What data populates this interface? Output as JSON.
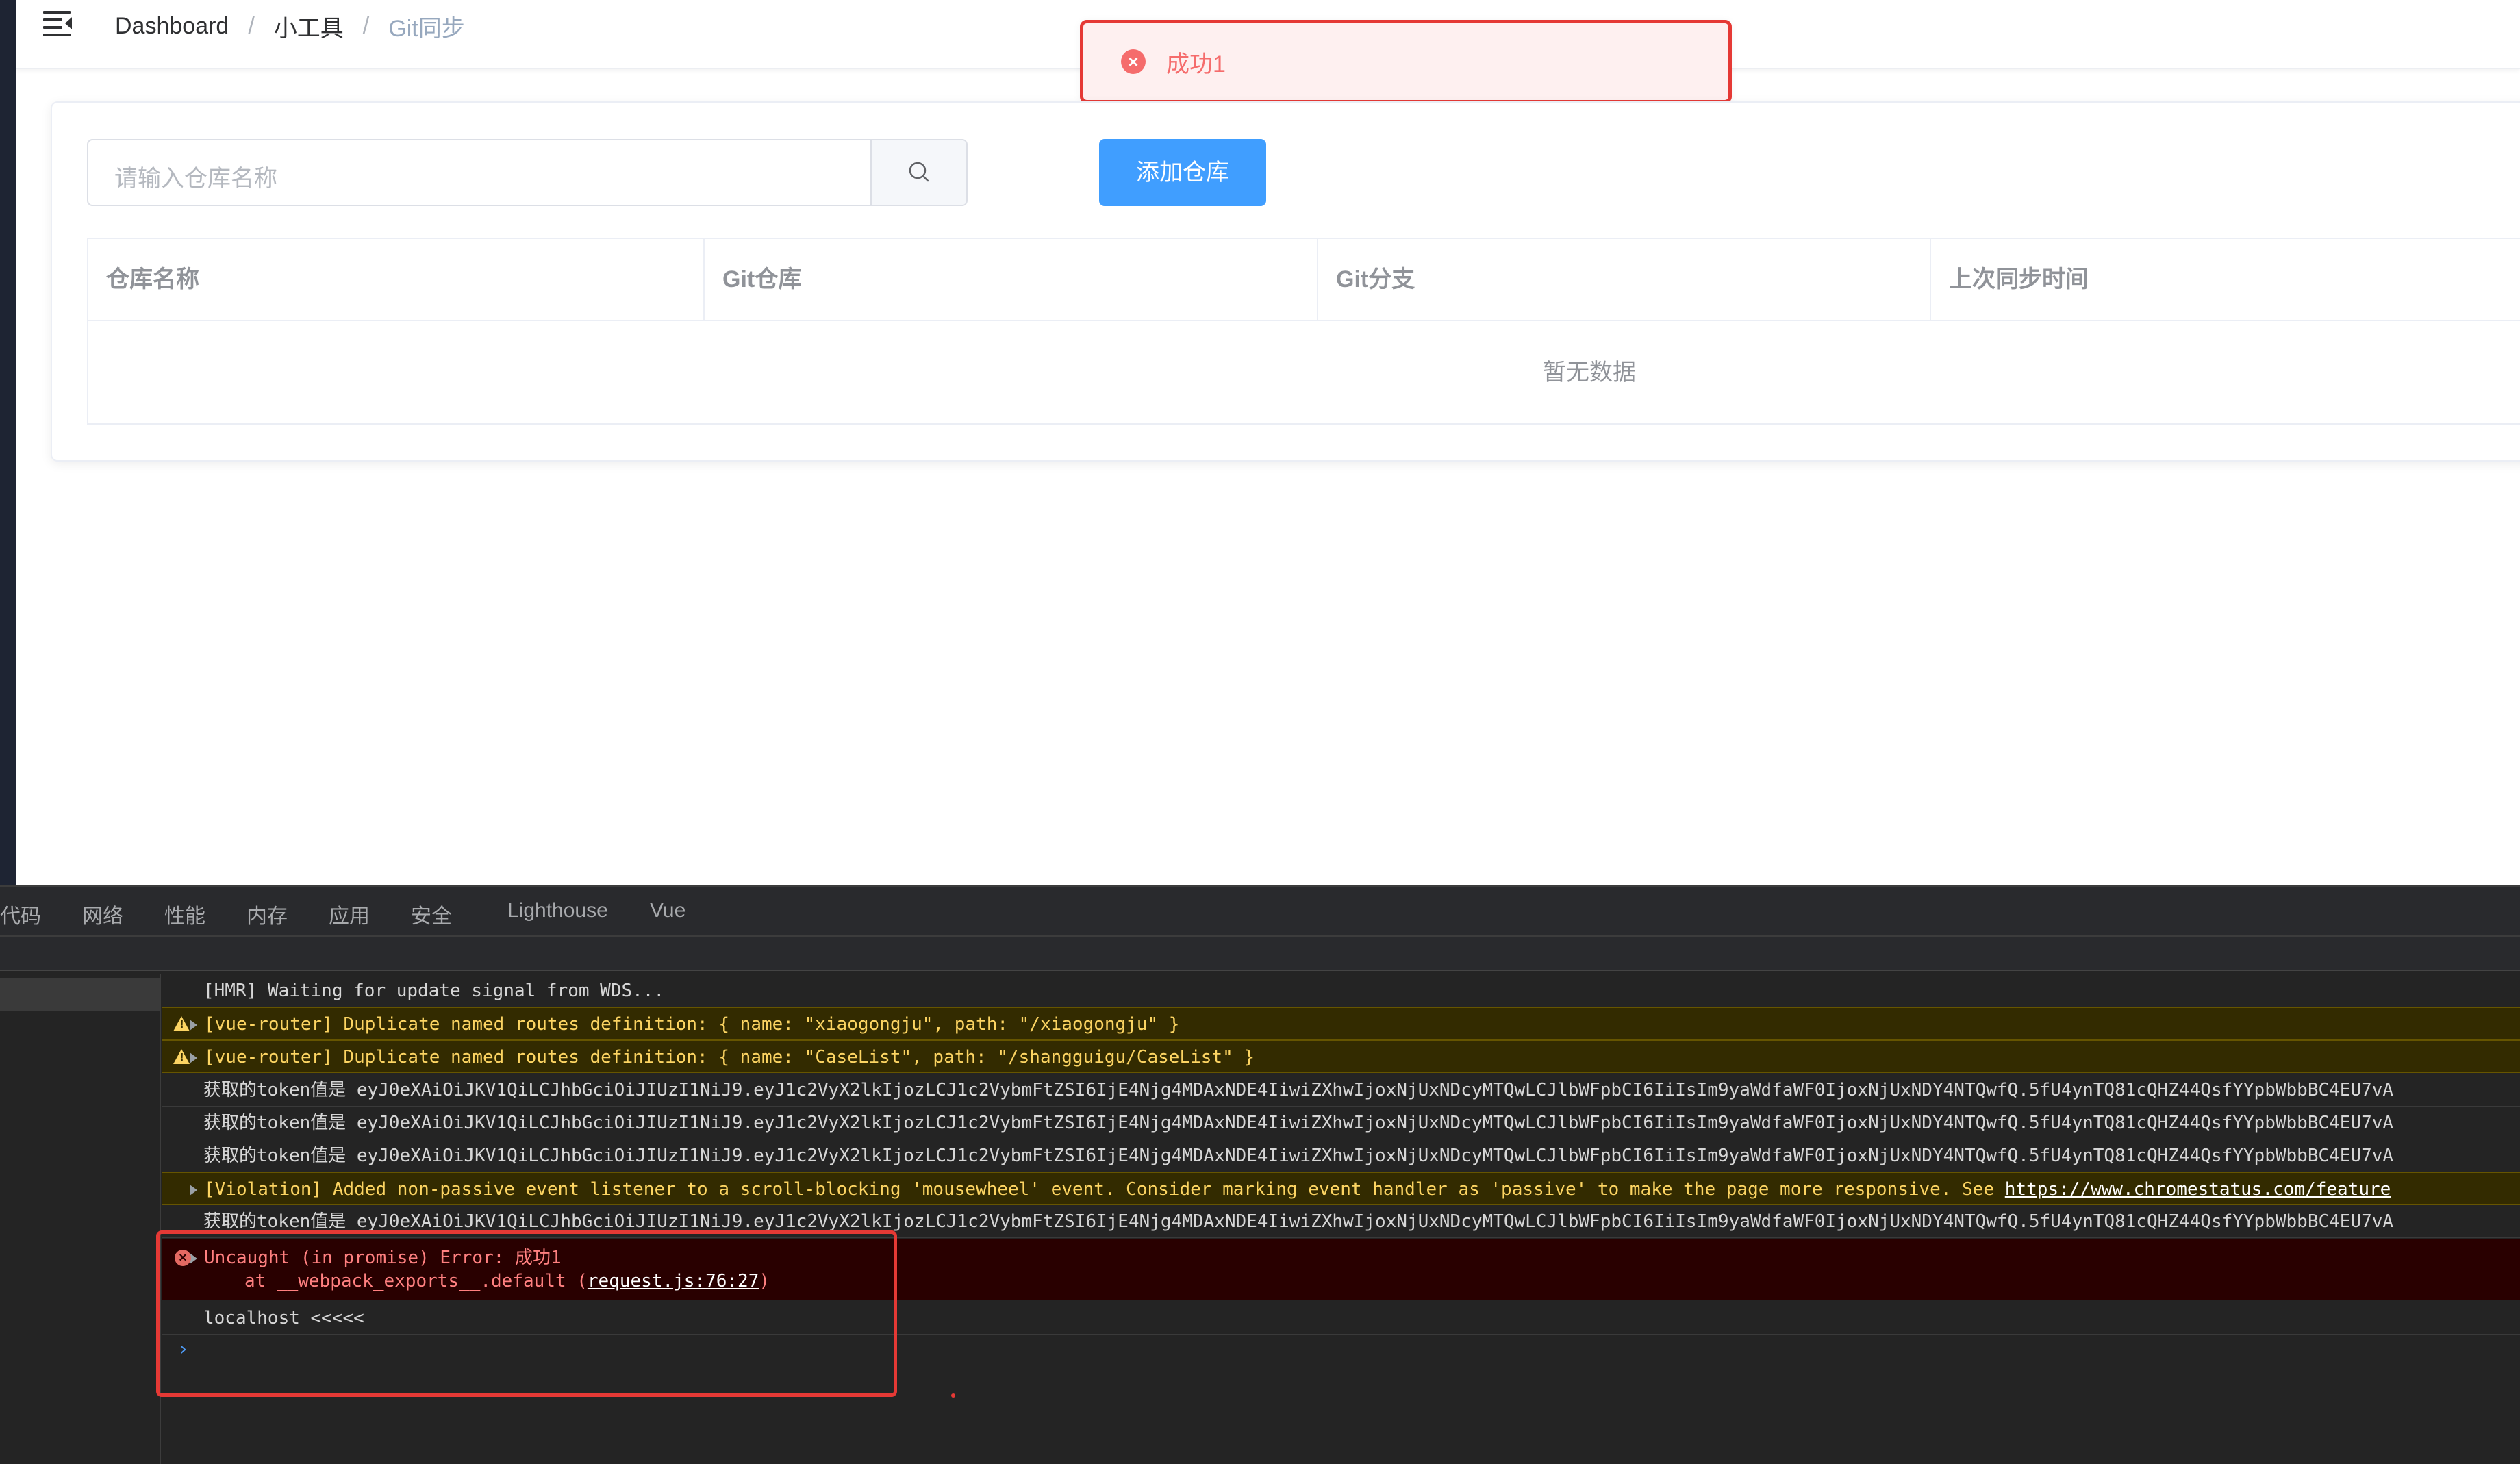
{
  "breadcrumb": {
    "items": [
      "Dashboard",
      "小工具",
      "Git同步"
    ],
    "separator": "/"
  },
  "toast": {
    "text": "成功1",
    "icon": "error-circle-icon",
    "color": "#f56c6c"
  },
  "search": {
    "placeholder": "请输入仓库名称",
    "button_icon": "search-icon"
  },
  "add_button": {
    "label": "添加仓库",
    "color": "#409eff"
  },
  "table": {
    "columns": [
      "仓库名称",
      "Git仓库",
      "Git分支",
      "上次同步时间"
    ],
    "empty_text": "暂无数据"
  },
  "devtools": {
    "tabs": [
      "代码",
      "网络",
      "性能",
      "内存",
      "应用",
      "安全",
      "Lighthouse",
      "Vue"
    ],
    "console": {
      "hmr": "[HMR] Waiting for update signal from WDS...",
      "warn1": "[vue-router] Duplicate named routes definition: { name: \"xiaogongju\", path: \"/xiaogongju\" }",
      "warn2": "[vue-router] Duplicate named routes definition: { name: \"CaseList\", path: \"/shangguigu/CaseList\" }",
      "token": "获取的token值是 eyJ0eXAiOiJKV1QiLCJhbGciOiJIUzI1NiJ9.eyJ1c2VyX2lkIjozLCJ1c2VybmFtZSI6IjE4Njg4MDAxNDE4IiwiZXhwIjoxNjUxNDcyMTQwLCJlbWFpbCI6IiIsIm9yaWdfaWF0IjoxNjUxNDY4NTQwfQ.5fU4ynTQ81cQHZ44QsfYYpbWbbBC4EU7vA",
      "violation": "[Violation] Added non-passive event listener to a scroll-blocking 'mousewheel' event. Consider marking event handler as 'passive' to make the page more responsive. See ",
      "violation_link": "https://www.chromestatus.com/feature",
      "error_line1": "Uncaught (in promise) Error: 成功1",
      "error_line2_prefix": "at __webpack_exports__.default (",
      "error_link": "request.js:76:27",
      "error_line2_suffix": ")",
      "localhost": "localhost <<<<<",
      "prompt": "›"
    }
  }
}
